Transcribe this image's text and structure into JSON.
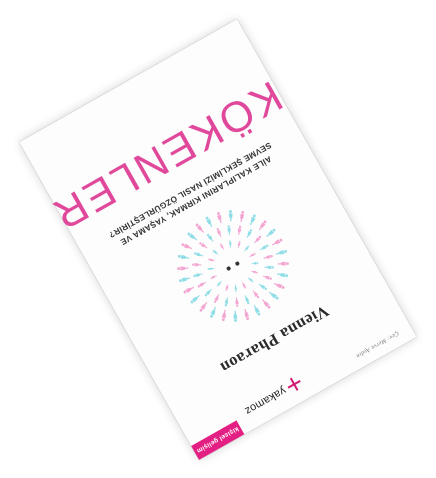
{
  "book": {
    "title": "KÖKENLER",
    "subtitle_line1": "AİLE KALIPLARINI KIRMAK, YAŞAMA VE",
    "subtitle_line2": "SEVME ŞEKLİMİZİ NASIL ÖZGÜRLEŞTİRİR?",
    "author": "Vienna Pharaon",
    "publisher": "yakamoz",
    "series_label": "kişisel gelişim",
    "translator": "Çev: Merve Aydın"
  },
  "colors": {
    "accent": "#e0489b",
    "publisher_pink": "#e31f83",
    "figure_pink": "#f3a6d2",
    "figure_cyan": "#8fdde6"
  }
}
